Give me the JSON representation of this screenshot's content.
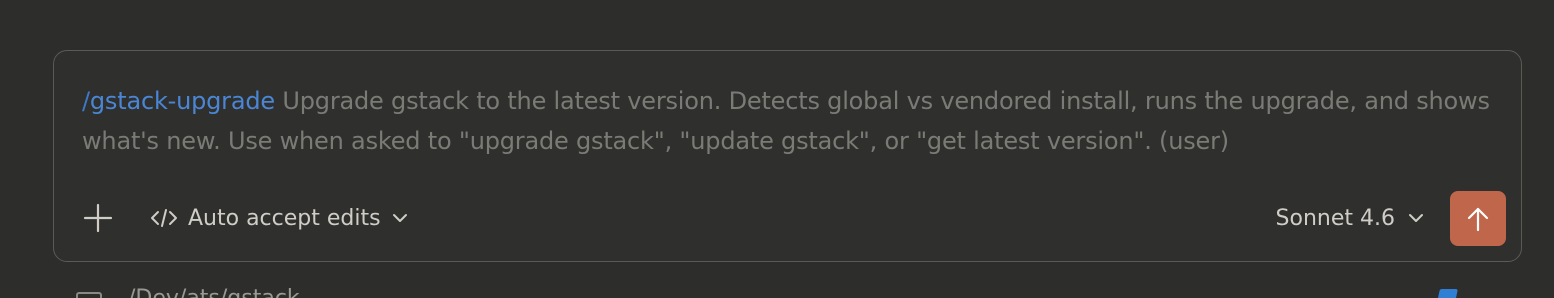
{
  "composer": {
    "command_slash": "/",
    "command_name": "gstack-upgrade",
    "command_description": "Upgrade gstack to the latest version. Detects global vs vendored install, runs the upgrade, and shows what's new. Use when asked to \"upgrade gstack\", \"update gstack\", or \"get latest version\". (user)",
    "add_icon": "plus-icon",
    "mode": {
      "icon": "code-icon",
      "label": "Auto accept edits"
    },
    "model": {
      "label": "Sonnet 4.6"
    },
    "send_icon": "arrow-up-icon"
  },
  "footer": {
    "path": "/Dev/ats/gstack"
  },
  "colors": {
    "background": "#2d2d2c",
    "command": "#4a86d4",
    "description": "#7b7b76",
    "send_button": "#c0664a"
  }
}
